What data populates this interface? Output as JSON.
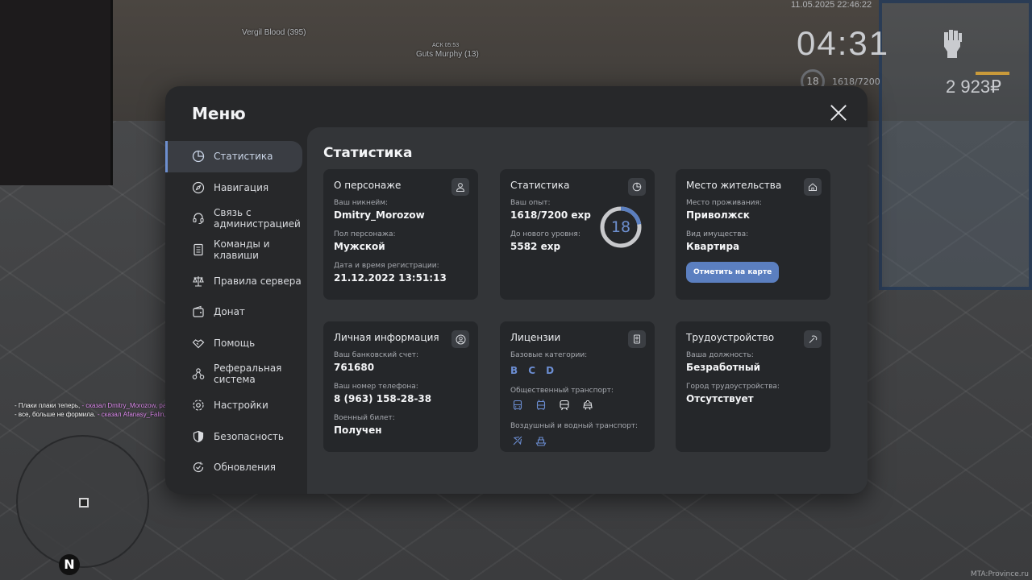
{
  "world": {
    "players": [
      {
        "name": "Vergil Blood (395)"
      },
      {
        "tag": "АСК 05:53",
        "name": "Guts Murphy (13)"
      }
    ],
    "hud": {
      "date": "11.05.2025 22:46:22",
      "time": "04:31",
      "level": "18",
      "exp": "1618/7200",
      "money": "2 923₽"
    },
    "chat": [
      {
        "text": "- Плаки плаки теперь, ",
        "quote": "- сказал Dmitry_Morozow, расстроившись"
      },
      {
        "text": "- все, больше не формила. ",
        "quote": "- сказал Afanasy_Falin, расстроившись"
      }
    ],
    "compass": "N",
    "corner": "MTA:Province.ru"
  },
  "menu": {
    "title": "Меню",
    "sidebar": [
      {
        "label": "Статистика",
        "icon": "pie-chart-icon",
        "active": true
      },
      {
        "label": "Навигация",
        "icon": "compass-icon"
      },
      {
        "label": "Связь с администрацией",
        "icon": "headset-icon"
      },
      {
        "label": "Команды и клавиши",
        "icon": "document-icon"
      },
      {
        "label": "Правила сервера",
        "icon": "scales-icon"
      },
      {
        "label": "Донат",
        "icon": "wallet-icon"
      },
      {
        "label": "Помощь",
        "icon": "handshake-icon"
      },
      {
        "label": "Реферальная система",
        "icon": "network-icon"
      },
      {
        "label": "Настройки",
        "icon": "settings-icon"
      },
      {
        "label": "Безопасность",
        "icon": "shield-icon"
      },
      {
        "label": "Обновления",
        "icon": "refresh-check-icon"
      }
    ],
    "content_title": "Статистика",
    "cards": {
      "character": {
        "title": "О персонаже",
        "nickname_label": "Ваш никнейм:",
        "nickname": "Dmitry_Morozow",
        "gender_label": "Пол персонажа:",
        "gender": "Мужской",
        "reg_label": "Дата и время регистрации:",
        "reg": "21.12.2022 13:51:13"
      },
      "stats": {
        "title": "Статистика",
        "exp_label": "Ваш опыт:",
        "exp": "1618/7200 exp",
        "next_label": "До нового уровня:",
        "next": "5582 exp",
        "level": "18",
        "progress": 0.2247
      },
      "residence": {
        "title": "Место жительства",
        "place_label": "Место проживания:",
        "place": "Приволжск",
        "property_label": "Вид имущества:",
        "property": "Квартира",
        "button": "Отметить на карте"
      },
      "personal": {
        "title": "Личная информация",
        "bank_label": "Ваш банковский счет:",
        "bank": "761680",
        "phone_label": "Ваш номер телефона:",
        "phone": "8 (963) 158-28-38",
        "military_label": "Военный билет:",
        "military": "Получен"
      },
      "licenses": {
        "title": "Лицензии",
        "base_label": "Базовые категории:",
        "base": [
          "B",
          "C",
          "D"
        ],
        "public_label": "Общественный транспорт:",
        "air_label": "Воздушный и водный транспорт:"
      },
      "job": {
        "title": "Трудоустройство",
        "position_label": "Ваша должность:",
        "position": "Безработный",
        "city_label": "Город трудоустройства:",
        "city": "Отсутствует"
      }
    }
  },
  "colors": {
    "accent": "#6d8fcf",
    "button": "#5b7fc0",
    "card": "#25272a",
    "panel": "#333538"
  }
}
